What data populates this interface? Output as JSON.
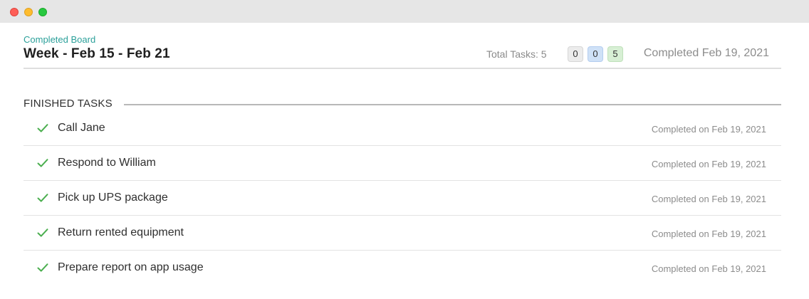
{
  "board": {
    "kicker": "Completed Board",
    "title": "Week - Feb 15 - Feb 21",
    "total_label": "Total Tasks: 5",
    "counts": [
      "0",
      "0",
      "5"
    ],
    "completed_label": "Completed Feb 19, 2021"
  },
  "section": {
    "title": "FINISHED TASKS"
  },
  "tasks": [
    {
      "label": "Call Jane",
      "completed": "Completed on Feb 19, 2021"
    },
    {
      "label": "Respond to William",
      "completed": "Completed on Feb 19, 2021"
    },
    {
      "label": "Pick up UPS package",
      "completed": "Completed on Feb 19, 2021"
    },
    {
      "label": "Return rented equipment",
      "completed": "Completed on Feb 19, 2021"
    },
    {
      "label": "Prepare report on app usage",
      "completed": "Completed on Feb 19, 2021"
    }
  ],
  "icons": {
    "task_done": "checkmark-icon"
  },
  "colors": {
    "accent": "#2ba09a",
    "check": "#4caf50",
    "close": "#fe5f57",
    "minimize": "#febc2e",
    "maximize": "#28c840"
  }
}
